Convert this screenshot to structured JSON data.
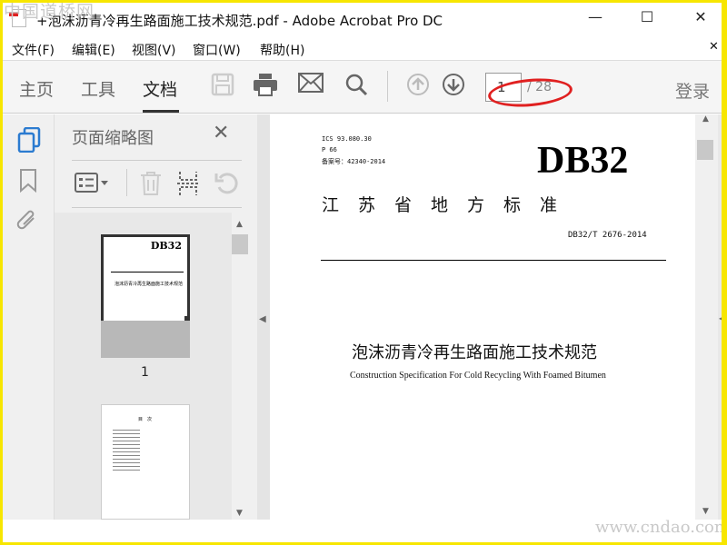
{
  "watermark": {
    "top": "中国道桥网",
    "bottom": "www.cndao.com"
  },
  "window": {
    "title": "+泡沫沥青冷再生路面施工技术规范.pdf - Adobe Acrobat Pro DC",
    "minimize": "—",
    "maximize": "☐",
    "close": "✕",
    "menu_close": "✕"
  },
  "menu": [
    "文件(F)",
    "编辑(E)",
    "视图(V)",
    "窗口(W)",
    "帮助(H)"
  ],
  "tabs": [
    "主页",
    "工具",
    "文档"
  ],
  "active_tab": "文档",
  "page": {
    "current": "1",
    "total": "/ 28"
  },
  "login": "登录",
  "accent_color": "#e02020",
  "panel": {
    "title": "页面缩略图",
    "close": "✕",
    "thumb_label": "1"
  },
  "doc": {
    "ics": "ICS 93.080.30",
    "p": "P 66",
    "record": "备案号：42340-2014",
    "db": "DB32",
    "standard": "江　苏　省　地　方　标　准",
    "code": "DB32/T 2676-2014",
    "title_cn": "泡沫沥青冷再生路面施工技术规范",
    "title_en": "Construction Specification For Cold Recycling With Foamed Bitumen"
  },
  "thumb": {
    "db": "DB32",
    "title": "泡沫沥青冷再生路面施工技术规范",
    "toc": "目　次"
  }
}
